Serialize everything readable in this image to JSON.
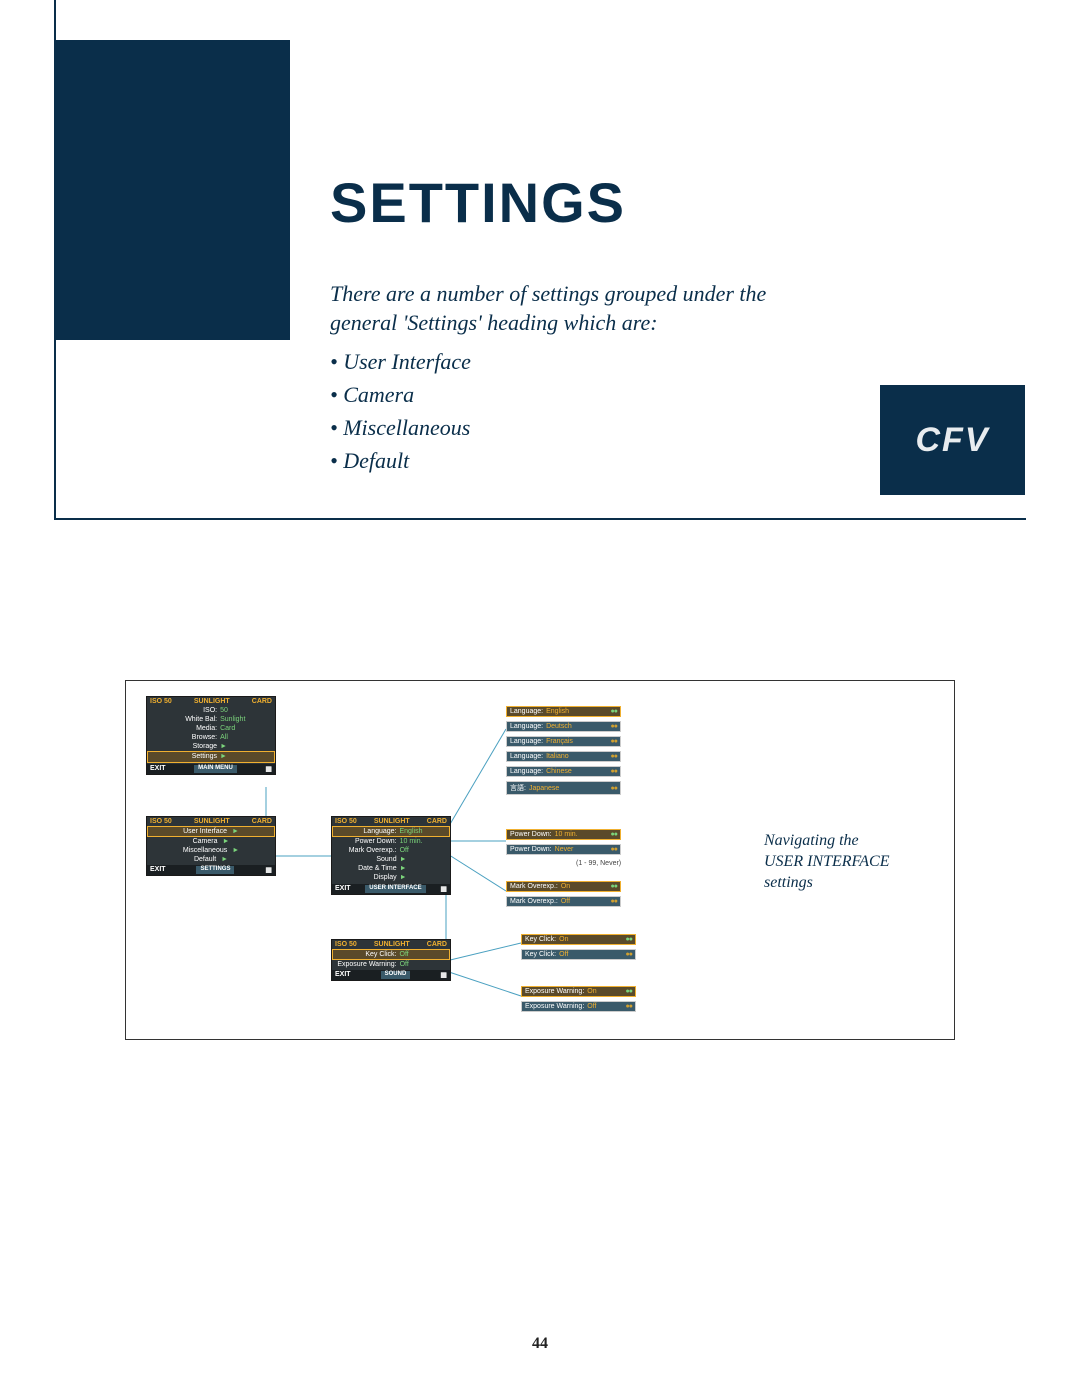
{
  "page": {
    "title": "Settings",
    "intro": "There are a number of settings grouped under the general 'Settings' heading which are:",
    "bullets": [
      "User Interface",
      "Camera",
      "Miscellaneous",
      "Default"
    ],
    "brand": "CFV",
    "page_number": "44"
  },
  "diagram": {
    "caption_line1": "Navigating the",
    "caption_line2": "USER INTERFACE",
    "caption_line3": "settings",
    "screen_main": {
      "hdr_left": "ISO 50",
      "hdr_mid": "SUNLIGHT",
      "hdr_right": "CARD",
      "rows": [
        {
          "lbl": "ISO:",
          "val": "50"
        },
        {
          "lbl": "White Bal:",
          "val": "Sunlight"
        },
        {
          "lbl": "Media:",
          "val": "Card"
        },
        {
          "lbl": "Browse:",
          "val": "All"
        },
        {
          "lbl": "Storage",
          "val": "►"
        },
        {
          "lbl": "Settings",
          "val": "►",
          "sel": true
        }
      ],
      "ftr_left": "EXIT",
      "ftr_mid": "MAIN MENU"
    },
    "screen_settings": {
      "hdr_left": "ISO 50",
      "hdr_mid": "SUNLIGHT",
      "hdr_right": "CARD",
      "rows": [
        {
          "lbl": "User Interface",
          "val": "►",
          "sel": true
        },
        {
          "lbl": "Camera",
          "val": "►"
        },
        {
          "lbl": "Miscellaneous",
          "val": "►"
        },
        {
          "lbl": "Default",
          "val": "►"
        }
      ],
      "ftr_left": "EXIT",
      "ftr_mid": "SETTINGS"
    },
    "screen_ui": {
      "hdr_left": "ISO 50",
      "hdr_mid": "SUNLIGHT",
      "hdr_right": "CARD",
      "rows": [
        {
          "lbl": "Language:",
          "val": "English",
          "sel": true
        },
        {
          "lbl": "Power Down:",
          "val": "10 min."
        },
        {
          "lbl": "Mark Overexp.:",
          "val": "Off"
        },
        {
          "lbl": "Sound",
          "val": "►"
        },
        {
          "lbl": "Date & Time",
          "val": "►"
        },
        {
          "lbl": "Display",
          "val": "►"
        }
      ],
      "ftr_left": "EXIT",
      "ftr_mid": "USER INTERFACE"
    },
    "screen_sound": {
      "hdr_left": "ISO 50",
      "hdr_mid": "SUNLIGHT",
      "hdr_right": "CARD",
      "rows": [
        {
          "lbl": "Key Click:",
          "val": "Off",
          "sel": true
        },
        {
          "lbl": "Exposure Warning:",
          "val": "Off"
        }
      ],
      "ftr_left": "EXIT",
      "ftr_mid": "SOUND"
    },
    "lang_opts": [
      {
        "l": "Language:",
        "v": "English",
        "sel": true
      },
      {
        "l": "Language:",
        "v": "Deutsch"
      },
      {
        "l": "Language:",
        "v": "Français"
      },
      {
        "l": "Language:",
        "v": "Italiano"
      },
      {
        "l": "Language:",
        "v": "Chinese"
      },
      {
        "l": "言語:",
        "v": "Japanese"
      }
    ],
    "power_opts": [
      {
        "l": "Power Down:",
        "v": "10 min.",
        "sel": true
      },
      {
        "l": "Power Down:",
        "v": "Never"
      }
    ],
    "power_note": "(1 - 99, Never)",
    "overexp_opts": [
      {
        "l": "Mark Overexp.:",
        "v": "On",
        "sel": true
      },
      {
        "l": "Mark Overexp.:",
        "v": "Off"
      }
    ],
    "keyclick_opts": [
      {
        "l": "Key Click:",
        "v": "On",
        "sel": true
      },
      {
        "l": "Key Click:",
        "v": "Off"
      }
    ],
    "expwarn_opts": [
      {
        "l": "Exposure Warning:",
        "v": "On",
        "sel": true
      },
      {
        "l": "Exposure Warning:",
        "v": "Off"
      }
    ]
  }
}
